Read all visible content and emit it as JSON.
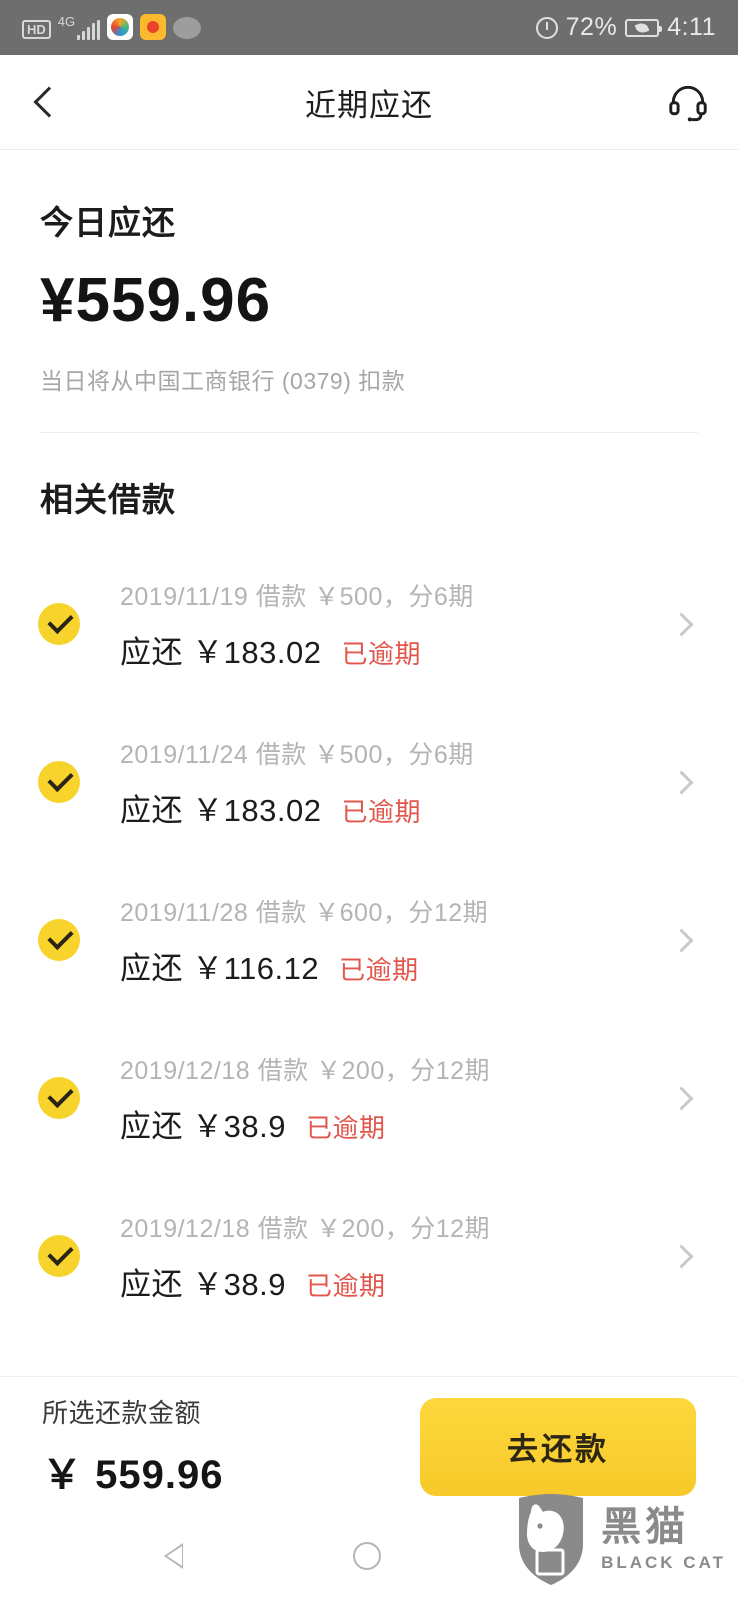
{
  "statusbar": {
    "hd_label": "HD",
    "network_label": "4G",
    "icons": [
      "hd-icon",
      "signal-icon",
      "kuaishou-app-icon",
      "weibo-app-icon",
      "wechat-app-icon",
      "alarm-icon",
      "battery-saver-icon"
    ],
    "battery_percent": "72%",
    "time": "4:11"
  },
  "header": {
    "title": "近期应还",
    "back_icon": "chevron-left-icon",
    "service_icon": "headset-icon"
  },
  "summary": {
    "title": "今日应还",
    "amount": "¥559.96",
    "note": "当日将从中国工商银行 (0379) 扣款"
  },
  "loans": {
    "section_title": "相关借款",
    "items": [
      {
        "meta": "2019/11/19 借款 ￥500，分6期",
        "due_label": "应还 ￥183.02",
        "status": "已逾期",
        "checked": true
      },
      {
        "meta": "2019/11/24 借款 ￥500，分6期",
        "due_label": "应还 ￥183.02",
        "status": "已逾期",
        "checked": true
      },
      {
        "meta": "2019/11/28 借款 ￥600，分12期",
        "due_label": "应还 ￥116.12",
        "status": "已逾期",
        "checked": true
      },
      {
        "meta": "2019/12/18 借款 ￥200，分12期",
        "due_label": "应还 ￥38.9",
        "status": "已逾期",
        "checked": true
      },
      {
        "meta": "2019/12/18 借款 ￥200，分12期",
        "due_label": "应还 ￥38.9",
        "status": "已逾期",
        "checked": true
      }
    ]
  },
  "bottombar": {
    "label": "所选还款金额",
    "amount": "￥ 559.96",
    "pay_button": "去还款"
  },
  "navbar": {
    "back_icon": "triangle-back-icon",
    "home_icon": "circle-home-icon",
    "recent_icon": "square-recents-icon"
  },
  "watermark": {
    "cn": "黑猫",
    "en": "BLACK CAT"
  },
  "colors": {
    "accent_yellow": "#F8D32B",
    "button_yellow": "#FCD83C",
    "overdue_red": "#E2574C",
    "statusbar_gray": "#6E6E6E",
    "muted_text": "#B4B4B4"
  }
}
